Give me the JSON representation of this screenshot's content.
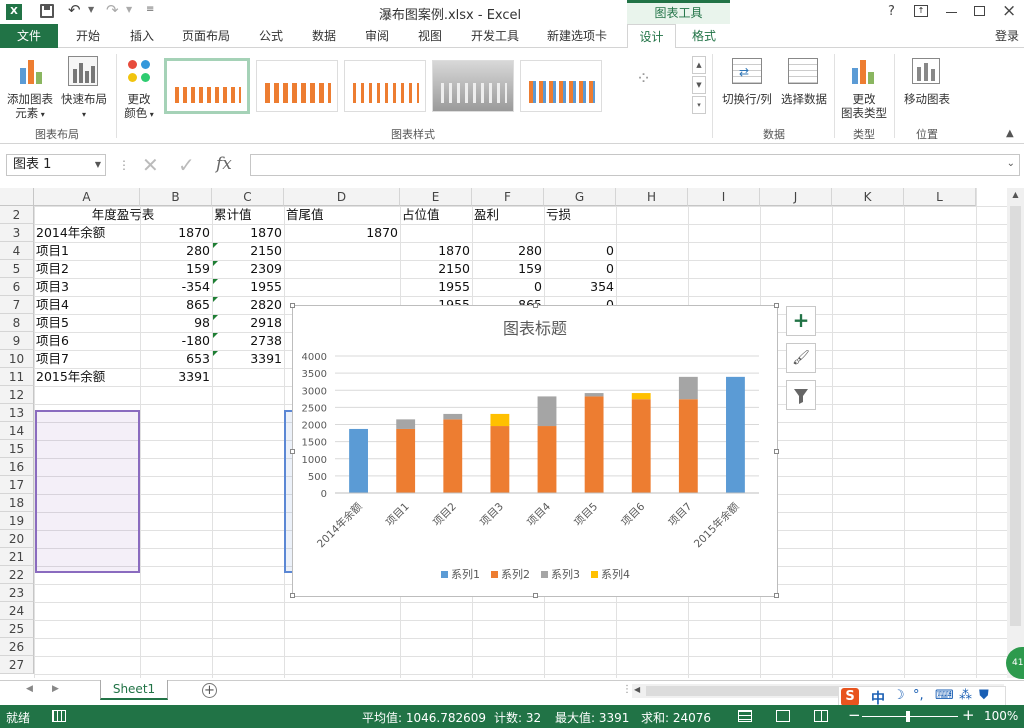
{
  "title": "瀑布图案例.xlsx - Excel",
  "context_tab": "图表工具",
  "login": "登录",
  "ribbon_tabs": [
    "文件",
    "开始",
    "插入",
    "页面布局",
    "公式",
    "数据",
    "审阅",
    "视图",
    "开发工具",
    "新建选项卡",
    "设计",
    "格式"
  ],
  "ribbon": {
    "add_element": [
      "添加图表",
      "元素"
    ],
    "quick_layout": [
      "快速布局"
    ],
    "change_color": [
      "更改",
      "颜色"
    ],
    "switch_row_col": "切换行/列",
    "select_data": "选择数据",
    "change_type": [
      "更改",
      "图表类型"
    ],
    "move_chart": "移动图表",
    "groups": {
      "layout": "图表布局",
      "styles": "图表样式",
      "data": "数据",
      "type": "类型",
      "location": "位置"
    }
  },
  "formula_bar": {
    "name_box": "图表 1",
    "fx": "fx",
    "formula": ""
  },
  "columns": [
    "A",
    "B",
    "C",
    "D",
    "E",
    "F",
    "G",
    "H",
    "I",
    "J",
    "K",
    "L"
  ],
  "rows": [
    "2",
    "3",
    "4",
    "5",
    "6",
    "7",
    "8",
    "9",
    "10",
    "11",
    "12",
    "13",
    "14",
    "15",
    "16",
    "17",
    "18",
    "19",
    "20",
    "21",
    "22",
    "23",
    "24",
    "25",
    "26",
    "27"
  ],
  "sheet": {
    "header": {
      "a": "年度盈亏表",
      "c": "累计值",
      "d": "首尾值",
      "e": "占位值",
      "f": "盈利",
      "g": "亏损"
    },
    "data_rows": [
      {
        "a": "2014年余额",
        "b": "1870",
        "c": "1870",
        "d": "1870",
        "e": "",
        "f": "",
        "g": ""
      },
      {
        "a": "项目1",
        "b": "280",
        "c": "2150",
        "d": "",
        "e": "1870",
        "f": "280",
        "g": "0"
      },
      {
        "a": "项目2",
        "b": "159",
        "c": "2309",
        "d": "",
        "e": "2150",
        "f": "159",
        "g": "0"
      },
      {
        "a": "项目3",
        "b": "-354",
        "c": "1955",
        "d": "",
        "e": "1955",
        "f": "0",
        "g": "354"
      },
      {
        "a": "项目4",
        "b": "865",
        "c": "2820",
        "d": "",
        "e": "1955",
        "f": "865",
        "g": "0"
      },
      {
        "a": "项目5",
        "b": "98",
        "c": "2918",
        "d": "",
        "e": "",
        "f": "",
        "g": ""
      },
      {
        "a": "项目6",
        "b": "-180",
        "c": "2738",
        "d": "",
        "e": "",
        "f": "",
        "g": ""
      },
      {
        "a": "项目7",
        "b": "653",
        "c": "3391",
        "d": "",
        "e": "",
        "f": "",
        "g": ""
      },
      {
        "a": "2015年余额",
        "b": "3391",
        "c": "",
        "d": "",
        "e": "",
        "f": "",
        "g": ""
      }
    ]
  },
  "sheet_tab": "Sheet1",
  "status": {
    "ready": "就绪",
    "average": "平均值: 1046.782609",
    "count": "计数: 32",
    "max": "最大值: 3391",
    "sum": "求和: 24076",
    "zoom": "100%"
  },
  "ime": {
    "lang": "中"
  },
  "colors": {
    "s1": "#5b9bd5",
    "s2": "#ed7d31",
    "s3": "#a5a5a5",
    "s4": "#ffc000",
    "excel_green": "#217346"
  },
  "chart_data": {
    "type": "bar",
    "stacked": true,
    "title": "图表标题",
    "categories": [
      "2014年余额",
      "项目1",
      "项目2",
      "项目3",
      "项目4",
      "项目5",
      "项目6",
      "项目7",
      "2015年余额"
    ],
    "series": [
      {
        "name": "系列1",
        "color": "#5b9bd5",
        "values": [
          1870,
          0,
          0,
          0,
          0,
          0,
          0,
          0,
          3391
        ]
      },
      {
        "name": "系列2",
        "color": "#ed7d31",
        "values": [
          0,
          1870,
          2150,
          1955,
          1955,
          2820,
          2738,
          2738,
          0
        ]
      },
      {
        "name": "系列3",
        "color": "#a5a5a5",
        "values": [
          0,
          280,
          159,
          0,
          865,
          98,
          0,
          653,
          0
        ]
      },
      {
        "name": "系列4",
        "color": "#ffc000",
        "values": [
          0,
          0,
          0,
          354,
          0,
          0,
          180,
          0,
          0
        ]
      }
    ],
    "yticks": [
      "0",
      "500",
      "1000",
      "1500",
      "2000",
      "2500",
      "3000",
      "3500",
      "4000"
    ],
    "ylim": [
      0,
      4000
    ],
    "legend": "bottom",
    "grid": true
  }
}
